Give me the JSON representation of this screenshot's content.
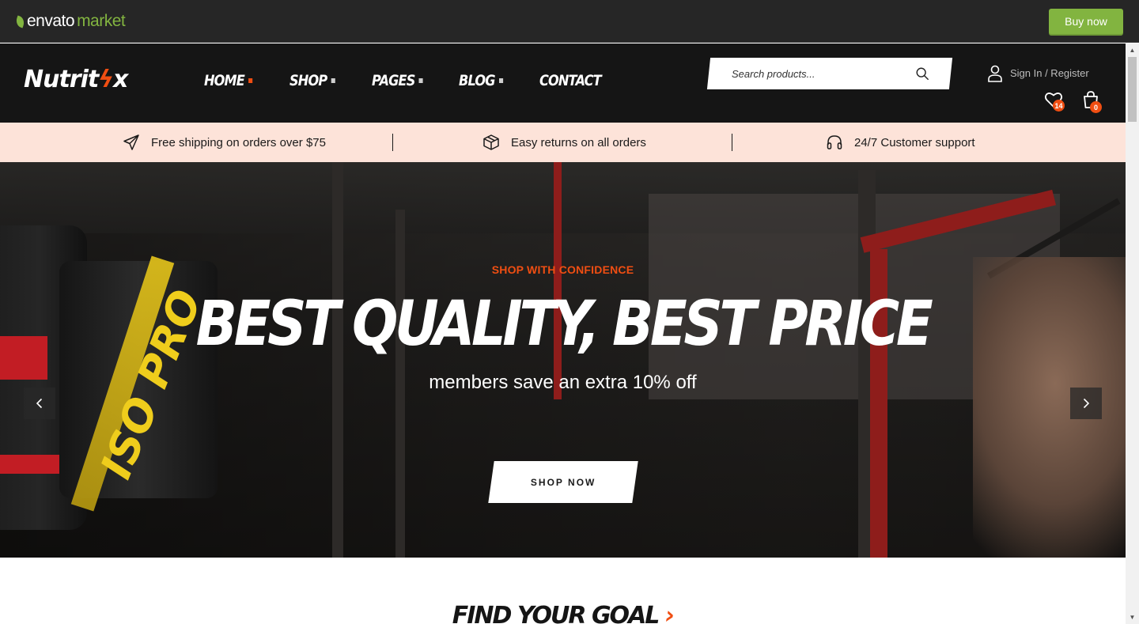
{
  "envato": {
    "logo_word1": "envato",
    "logo_word2": "market",
    "buy_now": "Buy now",
    "accent": "#82b440"
  },
  "site": {
    "logo_part1": "Nutrit",
    "logo_bolt": "ϟ",
    "logo_part2": "x",
    "brand_color": "#f04e12"
  },
  "nav": {
    "items": [
      {
        "label": "HOME",
        "has_dropdown": true,
        "active": true
      },
      {
        "label": "SHOP",
        "has_dropdown": true,
        "active": false
      },
      {
        "label": "PAGES",
        "has_dropdown": true,
        "active": false
      },
      {
        "label": "BLOG",
        "has_dropdown": true,
        "active": false
      },
      {
        "label": "CONTACT",
        "has_dropdown": false,
        "active": false
      }
    ]
  },
  "search": {
    "placeholder": "Search products...",
    "value": ""
  },
  "account": {
    "signin_label": "Sign In / Register",
    "wishlist_count": "14",
    "cart_count": "0"
  },
  "info_strip": {
    "shipping": "Free shipping on orders over $75",
    "returns": "Easy returns on all orders",
    "support": "24/7 Customer support"
  },
  "hero": {
    "kicker": "SHOP WITH CONFIDENCE",
    "title": "BEST QUALITY, BEST PRICE",
    "subtitle": "members save an extra 10% off",
    "cta": "SHOP NOW",
    "product_label": "ISO PRO"
  },
  "next_section": {
    "title": "FIND YOUR GOAL",
    "chevron": "›"
  }
}
